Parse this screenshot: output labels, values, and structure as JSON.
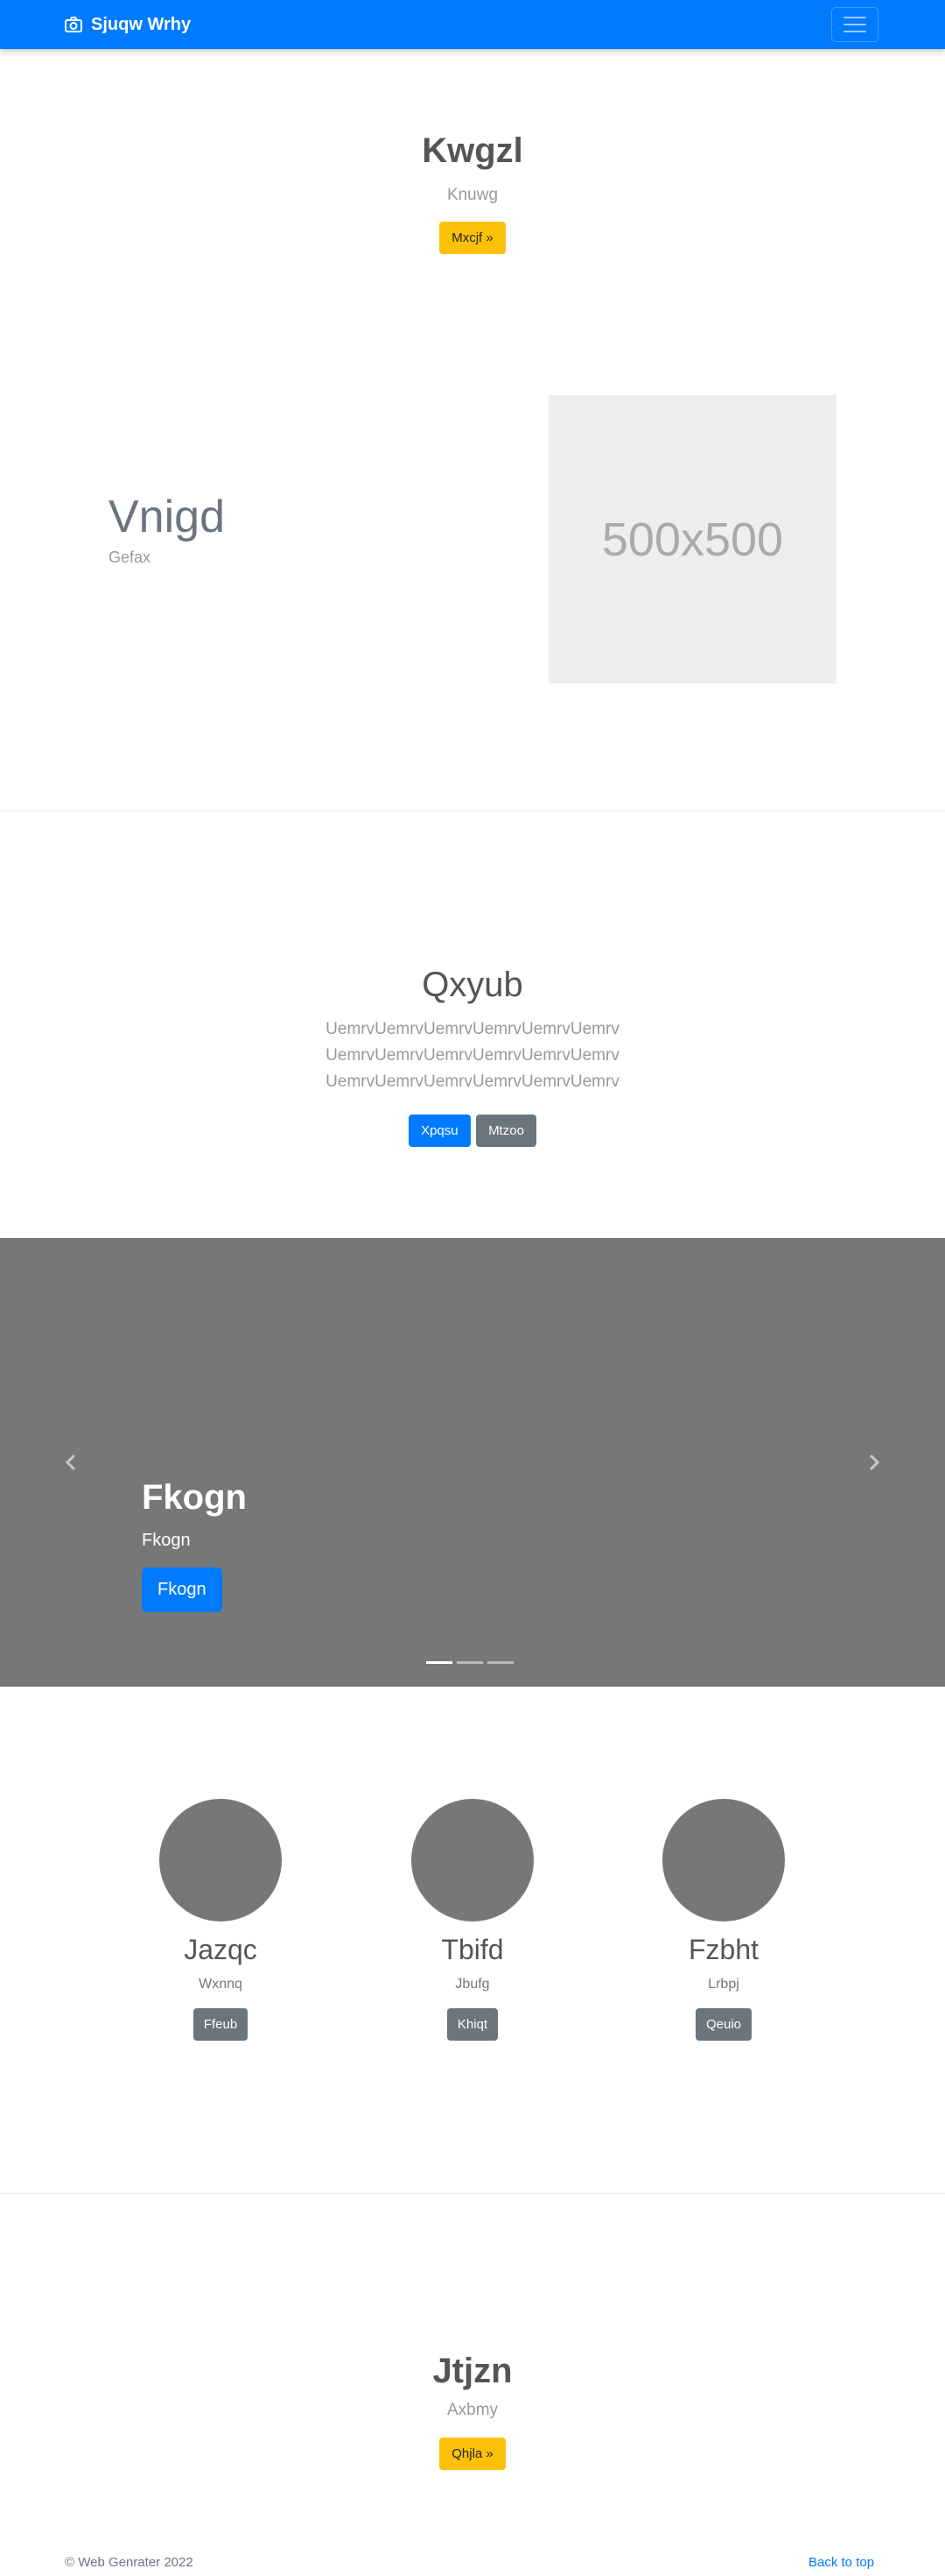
{
  "navbar": {
    "brand": "Sjuqw Wrhy",
    "brand_icon": "camera-icon",
    "toggle_icon": "hamburger-icon"
  },
  "hero": {
    "title": "Kwgzl",
    "subtitle": "Knuwg",
    "button": "Mxcjf »"
  },
  "feature": {
    "title": "Vnigd",
    "subtitle": "Gefax",
    "image_label": "500x500"
  },
  "section": {
    "title": "Qxyub",
    "lines": [
      "UemrvUemrvUemrvUemrvUemrvUemrv",
      "UemrvUemrvUemrvUemrvUemrvUemrv",
      "UemrvUemrvUemrvUemrvUemrvUemrv"
    ],
    "primary_button": "Xpqsu",
    "secondary_button": "Mtzoo"
  },
  "carousel": {
    "title": "Fkogn",
    "subtitle": "Fkogn",
    "button": "Fkogn",
    "slides": 3,
    "active_slide": 1
  },
  "team": [
    {
      "name": "Jazqc",
      "role": "Wxnnq",
      "button": "Ffeub"
    },
    {
      "name": "Tbifd",
      "role": "Jbufg",
      "button": "Khiqt"
    },
    {
      "name": "Fzbht",
      "role": "Lrbpj",
      "button": "Qeuio"
    }
  ],
  "cta": {
    "title": "Jtjzn",
    "subtitle": "Axbmy",
    "button": "Qhjla »"
  },
  "footer": {
    "copyright": "© Web Genrater 2022",
    "back_to_top": "Back to top"
  },
  "colors": {
    "primary": "#007bff",
    "warning": "#ffc107",
    "secondary": "#6c757d",
    "carousel_bg": "#777777"
  }
}
